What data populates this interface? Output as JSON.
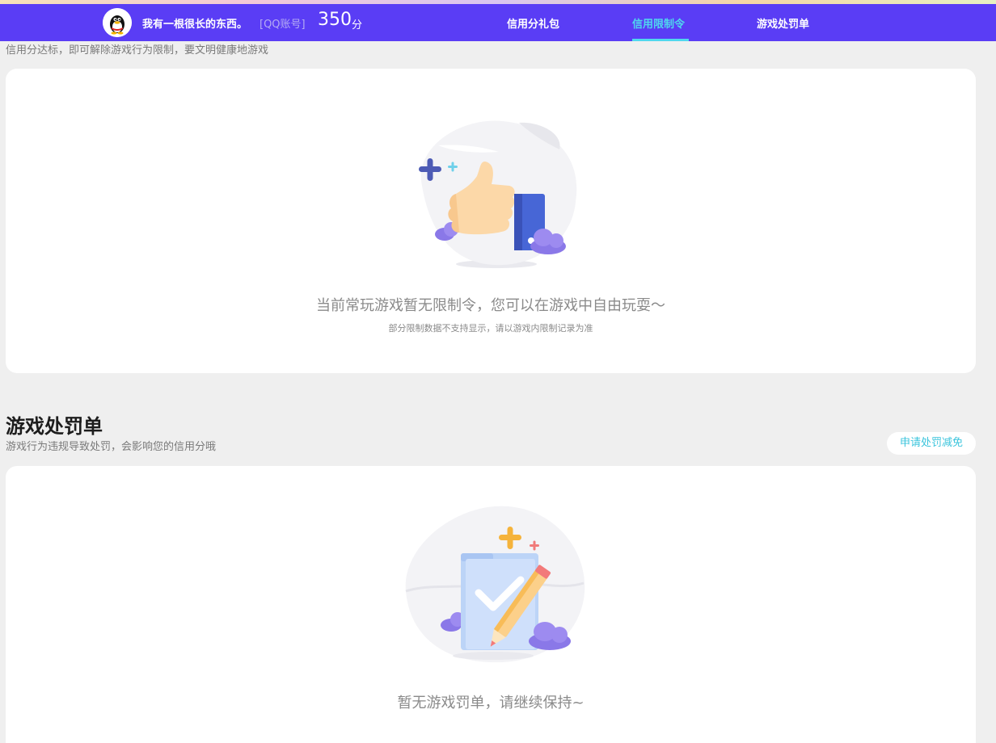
{
  "header": {
    "nickname": "我有一根很长的东西。",
    "account_tag": "[QQ账号]",
    "score": "350",
    "score_unit": "分",
    "avatar_icon": "qq-penguin-icon",
    "nav": [
      {
        "label": "信用分礼包",
        "active": false
      },
      {
        "label": "信用限制令",
        "active": true
      },
      {
        "label": "游戏处罚单",
        "active": false
      }
    ]
  },
  "restriction": {
    "subtitle": "信用分达标，即可解除游戏行为限制，要文明健康地游戏",
    "empty_message": "当前常玩游戏暂无限制令，您可以在游戏中自由玩耍～",
    "empty_note": "部分限制数据不支持显示，请以游戏内限制记录为准",
    "illustration_icon": "thumbs-up-icon"
  },
  "penalty": {
    "title": "游戏处罚单",
    "subtitle": "游戏行为违规导致处罚，会影响您的信用分哦",
    "appeal_button": "申请处罚减免",
    "empty_message": "暂无游戏罚单，请继续保持~",
    "illustration_icon": "checklist-pencil-icon"
  },
  "colors": {
    "nav_bg": "#5a3df5",
    "nav_active": "#4fd8ee",
    "accent": "#3ac4dc",
    "page_bg": "#efefef"
  }
}
